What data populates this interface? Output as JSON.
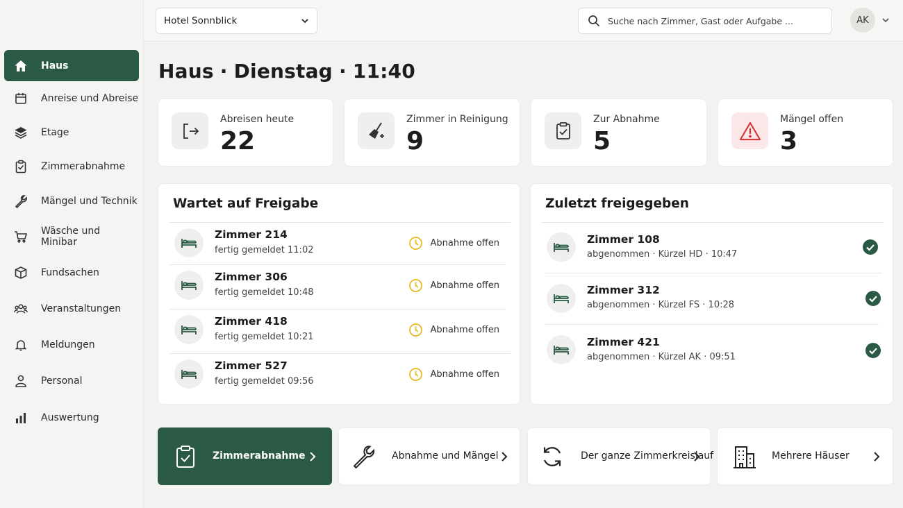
{
  "topbar": {
    "hotel": "Hotel Sonnblick",
    "search_placeholder": "Suche nach Zimmer, Gast oder Aufgabe ...",
    "avatar_initials": "AK"
  },
  "sidebar": {
    "items": [
      {
        "label": "Haus",
        "icon": "home-icon",
        "active": true
      },
      {
        "label": "Anreise und Abreise",
        "icon": "calendar-icon"
      },
      {
        "label": "Etage",
        "icon": "layers-icon"
      },
      {
        "label": "Zimmerabnahme",
        "icon": "clipboard-check-icon"
      },
      {
        "label": "Mängel und Technik",
        "icon": "wrench-icon"
      },
      {
        "label": "Wäsche und Minibar",
        "icon": "cart-icon"
      },
      {
        "label": "Fundsachen",
        "icon": "box-icon"
      },
      {
        "label": "Veranstaltungen",
        "icon": "people-icon"
      },
      {
        "label": "Meldungen",
        "icon": "bell-icon"
      },
      {
        "label": "Personal",
        "icon": "person-icon"
      },
      {
        "label": "Auswertung",
        "icon": "bar-chart-icon"
      }
    ]
  },
  "heading": {
    "section": "Haus",
    "day": "Dienstag",
    "time": "11:40",
    "separator": "·"
  },
  "stats": [
    {
      "label": "Abreisen heute",
      "value": "22",
      "icon": "logout-icon"
    },
    {
      "label": "Zimmer in Reinigung",
      "value": "9",
      "icon": "broom-icon"
    },
    {
      "label": "Zur Abnahme",
      "value": "5",
      "icon": "clipboard-check-icon"
    },
    {
      "label": "Mängel offen",
      "value": "3",
      "icon": "warning-icon"
    }
  ],
  "pending": {
    "title": "Wartet auf Freigabe",
    "rows": [
      {
        "room": "Zimmer 214",
        "sub": "fertig gemeldet  11:02",
        "status": "Abnahme offen"
      },
      {
        "room": "Zimmer 306",
        "sub": "fertig gemeldet  10:48",
        "status": "Abnahme offen"
      },
      {
        "room": "Zimmer 418",
        "sub": "fertig gemeldet  10:21",
        "status": "Abnahme offen"
      },
      {
        "room": "Zimmer 527",
        "sub": "fertig gemeldet  09:56",
        "status": "Abnahme offen"
      }
    ]
  },
  "released": {
    "title": "Zuletzt freigegeben",
    "rows": [
      {
        "room": "Zimmer 108",
        "sub": "abgenommen  ·  Kürzel HD  ·  10:47"
      },
      {
        "room": "Zimmer 312",
        "sub": "abgenommen  ·  Kürzel FS  ·  10:28"
      },
      {
        "room": "Zimmer 421",
        "sub": "abgenommen  ·  Kürzel AK  ·  09:51"
      }
    ]
  },
  "shortcuts": [
    {
      "label": "Zimmerabnahme",
      "icon": "clipboard-check-icon",
      "active": true
    },
    {
      "label": "Abnahme und Mängel",
      "icon": "wrench-icon"
    },
    {
      "label": "Der ganze Zimmerkreislauf",
      "icon": "refresh-icon"
    },
    {
      "label": "Mehrere Häuser",
      "icon": "building-icon"
    }
  ],
  "colors": {
    "accent": "#2a5a45",
    "clock": "#e8b923",
    "check": "#2a5a45",
    "alert": "#d23a3a"
  }
}
